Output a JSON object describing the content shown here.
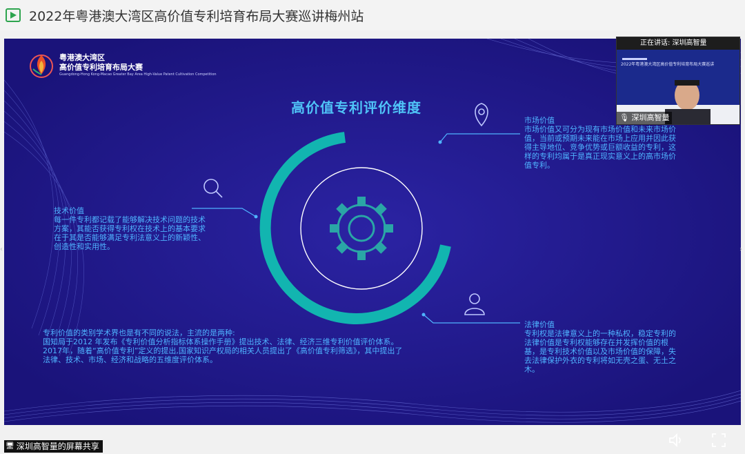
{
  "window": {
    "title": "2022年粤港澳大湾区高价值专利培育布局大赛巡讲梅州站"
  },
  "logo": {
    "line1": "粤港澳大湾区",
    "line2": "高价值专利培育布局大赛",
    "sub": "Guangdong-Hong Kong-Macao Greater Bay Area High-Value Patent Cultivation Competition"
  },
  "slide": {
    "title": "高价值专利评价维度",
    "tech": {
      "heading": "技术价值",
      "body": "每一件专利都记载了能够解决技术问题的技术方案，其能否获得专利权在技术上的基本要求在于其是否能够满足专利法意义上的新颖性、创造性和实用性。"
    },
    "market": {
      "heading": "市场价值",
      "body": "市场价值又可分为现有市场价值和未来市场价值，当前或预期未来能在市场上应用并因此获得主导地位、竞争优势或巨额收益的专利，这样的专利均属于是真正现实意义上的高市场价值专利。"
    },
    "legal": {
      "heading": "法律价值",
      "body": "专利权是法律意义上的一种私权，稳定专利的法律价值是专利权能够存在并发挥价值的根基，是专利技术价值以及市场价值的保障，失去法律保护外衣的专利将如无壳之蛋、无土之木。"
    },
    "note": {
      "line1": "专利价值的类别学术界也是有不同的说法，主流的是两种:",
      "line2": "国知局于2012 年发布《专利价值分析指标体系操作手册》提出技术、法律、经济三维专利价值评价体系。",
      "line3": "2017年，随着“高价值专利”定义的提出,国家知识产权局的相关人员提出了《高价值专利筛选》，其中提出了法律、技术、市场、经济和战略的五维度评价体系。"
    }
  },
  "video": {
    "speaking_label": "正在讲话: 深圳高智量",
    "participant": "深圳高智量",
    "mini_title": "2022年粤港澳大湾区高价值专利培育布局大赛巡讲"
  },
  "share": {
    "label": "深圳高智量的屏幕共享"
  },
  "colors": {
    "stage": "#221a8a",
    "accent": "#4fb4ff",
    "ring": "#12b5b0"
  }
}
